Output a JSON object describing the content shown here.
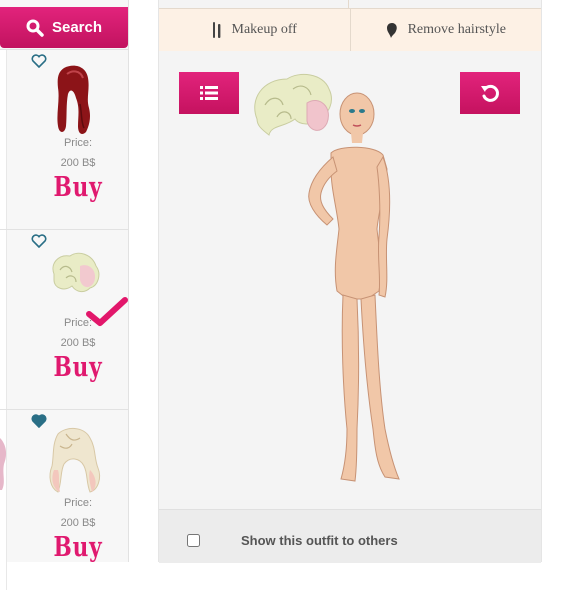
{
  "search": {
    "label": "Search"
  },
  "shop_items": [
    {
      "price_label": "Price:",
      "price_value": "200 B$",
      "buy_label": "Buy",
      "favorited": false
    },
    {
      "price_label": "Price:",
      "price_value": "200 B$",
      "buy_label": "Buy",
      "favorited": false,
      "selected": true
    },
    {
      "price_label": "Price:",
      "price_value": "200 B$",
      "buy_label": "Buy",
      "favorited": true
    }
  ],
  "tabs": {
    "makeup_off": "Makeup  off",
    "remove_hairstyle": "Remove  hairstyle"
  },
  "footer": {
    "show_outfit_label": "Show this outfit to others",
    "show_outfit_checked": false
  },
  "colors": {
    "accent": "#d4176a",
    "check": "#e2176b",
    "heart": "#2a6f86",
    "hair_red": "#8c1418"
  },
  "icons": [
    "search-icon",
    "heart-outline-icon",
    "heart-filled-icon",
    "checkmark-icon",
    "makeup-brush-icon",
    "hair-icon",
    "list-icon",
    "undo-icon"
  ]
}
